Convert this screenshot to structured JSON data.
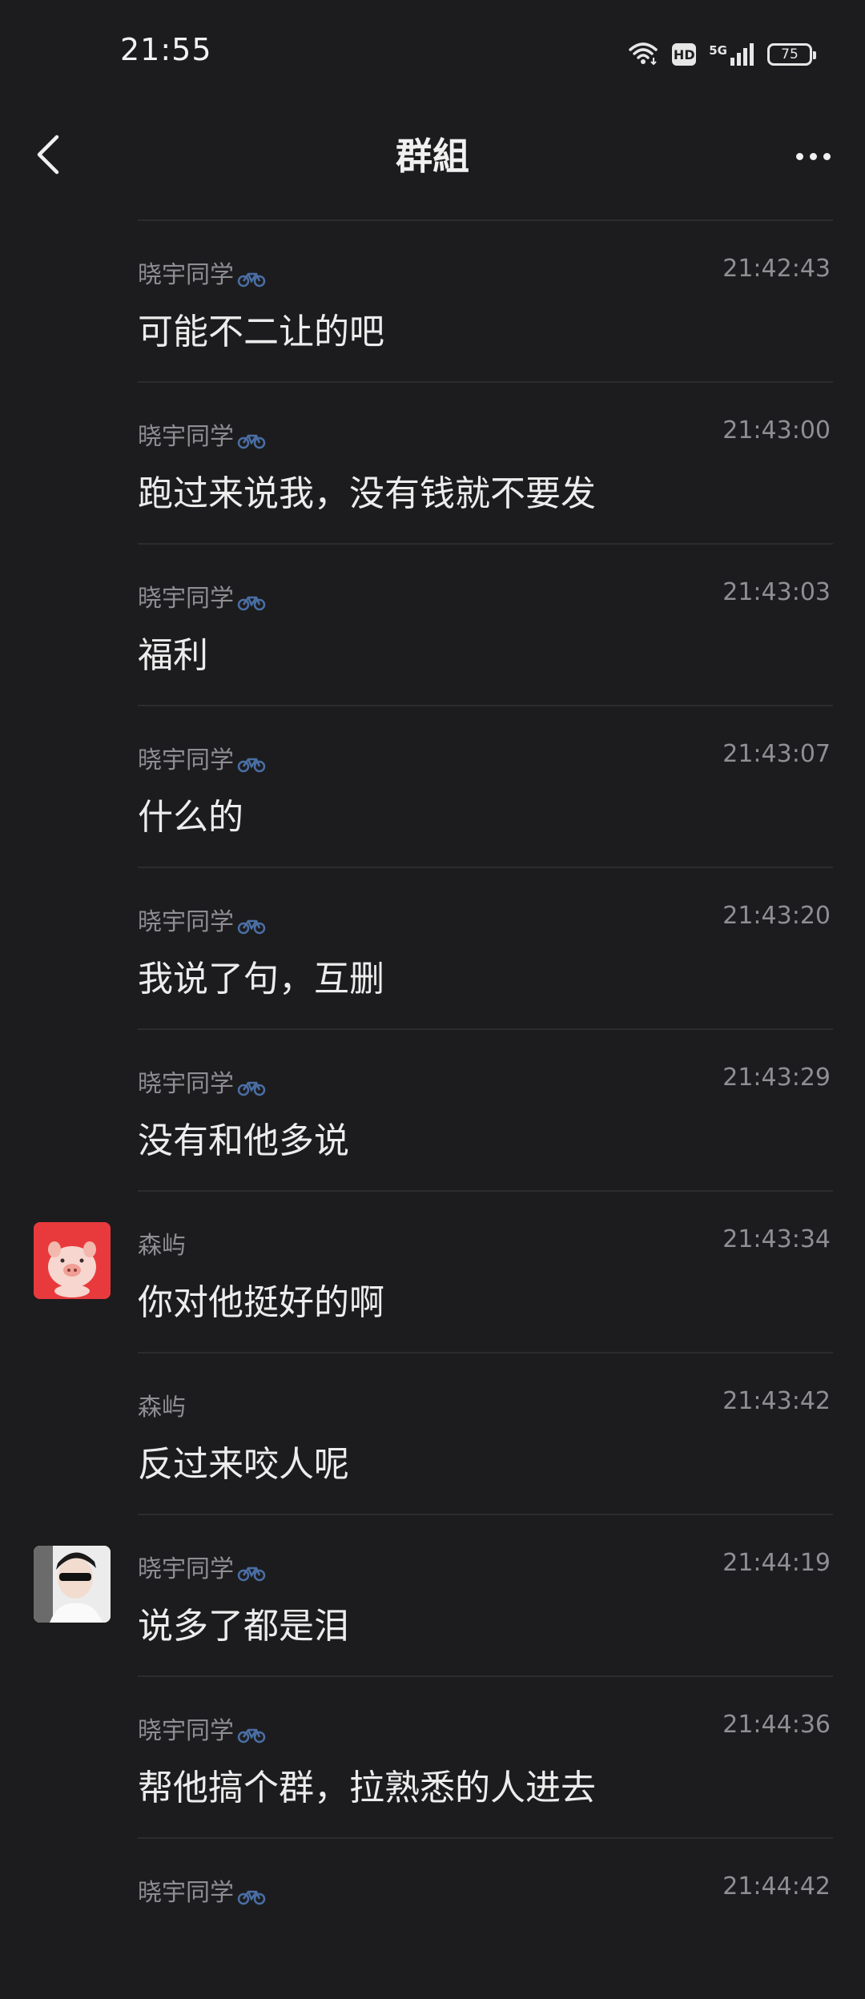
{
  "status_bar": {
    "time": "21:55",
    "network": "5G",
    "hd": "HD",
    "battery": "75"
  },
  "header": {
    "title": "群組"
  },
  "messages": [
    {
      "sender": "晓宇同学",
      "time": "21:42:43",
      "text": "可能不二让的吧",
      "avatar": null,
      "badge": "bike-icon"
    },
    {
      "sender": "晓宇同学",
      "time": "21:43:00",
      "text": "跑过来说我，没有钱就不要发",
      "avatar": null,
      "badge": "bike-icon"
    },
    {
      "sender": "晓宇同学",
      "time": "21:43:03",
      "text": "福利",
      "avatar": null,
      "badge": "bike-icon"
    },
    {
      "sender": "晓宇同学",
      "time": "21:43:07",
      "text": "什么的",
      "avatar": null,
      "badge": "bike-icon"
    },
    {
      "sender": "晓宇同学",
      "time": "21:43:20",
      "text": "我说了句，互删",
      "avatar": null,
      "badge": "bike-icon"
    },
    {
      "sender": "晓宇同学",
      "time": "21:43:29",
      "text": "没有和他多说",
      "avatar": null,
      "badge": "bike-icon"
    },
    {
      "sender": "森屿",
      "time": "21:43:34",
      "text": "你对他挺好的啊",
      "avatar": "pig-avatar",
      "badge": null
    },
    {
      "sender": "森屿",
      "time": "21:43:42",
      "text": "反过来咬人呢",
      "avatar": null,
      "badge": null
    },
    {
      "sender": "晓宇同学",
      "time": "21:44:19",
      "text": "说多了都是泪",
      "avatar": "photo-avatar",
      "badge": "bike-icon"
    },
    {
      "sender": "晓宇同学",
      "time": "21:44:36",
      "text": "帮他搞个群，拉熟悉的人进去",
      "avatar": null,
      "badge": "bike-icon"
    },
    {
      "sender": "晓宇同学",
      "time": "21:44:42",
      "text": "",
      "avatar": null,
      "badge": "bike-icon"
    }
  ],
  "colors": {
    "background": "#1c1c1e",
    "divider": "#2c2c2e",
    "meta_text": "#8e8e93",
    "body_text": "#ececec",
    "bike_icon": "#4a6fa5",
    "pig_avatar_bg": "#e83a3d"
  }
}
